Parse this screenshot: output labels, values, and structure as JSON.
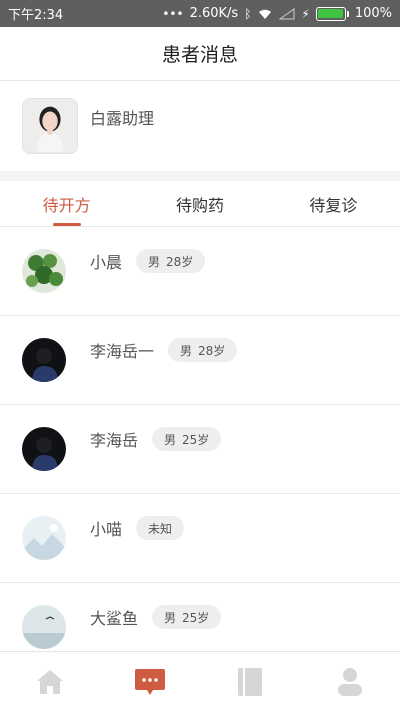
{
  "status": {
    "time": "下午2:34",
    "speed": "2.60K/s",
    "battery_text": "100%",
    "battery_level": 1.0
  },
  "header": {
    "title": "患者消息"
  },
  "assistant": {
    "name": "白露助理"
  },
  "tabs": [
    {
      "label": "待开方",
      "active": true
    },
    {
      "label": "待购药",
      "active": false
    },
    {
      "label": "待复诊",
      "active": false
    }
  ],
  "patients": [
    {
      "name": "小晨",
      "gender": "男",
      "age": "28岁"
    },
    {
      "name": "李海岳一",
      "gender": "男",
      "age": "28岁"
    },
    {
      "name": "李海岳",
      "gender": "男",
      "age": "25岁"
    },
    {
      "name": "小喵",
      "gender": "未知",
      "age": ""
    },
    {
      "name": "大鲨鱼",
      "gender": "男",
      "age": "25岁"
    }
  ],
  "tabbar": [
    {
      "icon": "home-icon",
      "active": false
    },
    {
      "icon": "message-icon",
      "active": true
    },
    {
      "icon": "book-icon",
      "active": false
    },
    {
      "icon": "person-icon",
      "active": false
    }
  ],
  "colors": {
    "accent": "#cf5b42",
    "inactive_icon": "#d6d6d6",
    "statusbar": "#5f5f5f"
  }
}
